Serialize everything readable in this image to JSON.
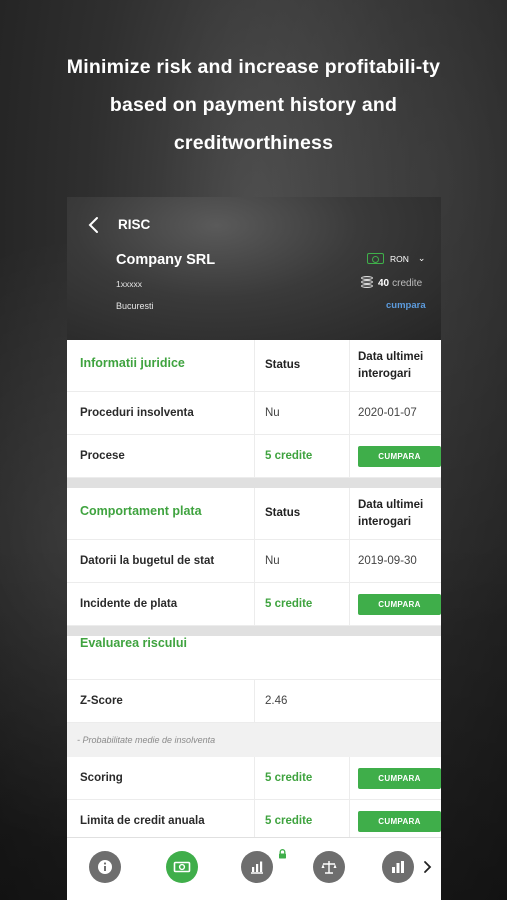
{
  "headline": "Minimize risk and increase profitabili-ty based on payment history and creditworthiness",
  "header": {
    "title": "RISC",
    "company_name": "Company SRL",
    "company_id": "1xxxxx",
    "city": "Bucuresti",
    "currency": "RON",
    "credits_count": "40",
    "credits_label": "credite",
    "buy_link": "cumpara"
  },
  "sections": {
    "legal": {
      "title": "Informatii juridice",
      "col_status": "Status",
      "col_date": "Data ultimei interogari",
      "rows": [
        {
          "label": "Proceduri insolventa",
          "status": "Nu",
          "date": "2020-01-07"
        },
        {
          "label": "Procese",
          "status": "5 credite",
          "button": "CUMPARA"
        }
      ]
    },
    "payment": {
      "title": "Comportament plata",
      "col_status": "Status",
      "col_date": "Data ultimei interogari",
      "rows": [
        {
          "label": "Datorii la bugetul de stat",
          "status": "Nu",
          "date": "2019-09-30"
        },
        {
          "label": "Incidente de plata",
          "status": "5 credite",
          "button": "CUMPARA"
        }
      ]
    },
    "risk": {
      "title": "Evaluarea riscului",
      "zscore_label": "Z-Score",
      "zscore_value": "2.46",
      "note": "- Probabilitate medie de insolventa",
      "rows": [
        {
          "label": "Scoring",
          "status": "5 credite",
          "button": "CUMPARA"
        },
        {
          "label": "Limita de credit anuala",
          "status": "5 credite",
          "button": "CUMPARA"
        }
      ]
    }
  },
  "colors": {
    "accent_green": "#3fae4a",
    "link_blue": "#5c9bdd",
    "nav_gray": "#6e6e6e"
  },
  "bottom_nav": {
    "icons": [
      "info-icon",
      "money-icon",
      "chart-icon",
      "scales-icon",
      "bar-chart-icon"
    ],
    "active_index": 1,
    "locked_index": 2
  }
}
